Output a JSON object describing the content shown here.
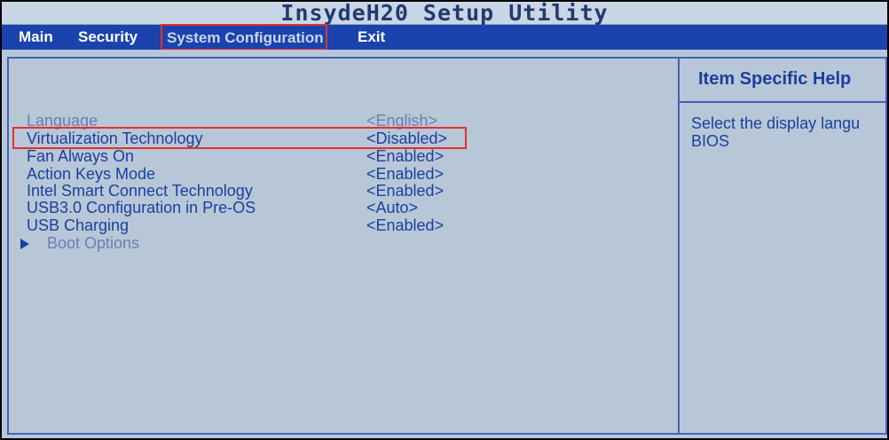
{
  "app": {
    "title": "InsydeH20 Setup Utility"
  },
  "menu": {
    "items": [
      {
        "label": "Main"
      },
      {
        "label": "Security"
      },
      {
        "label": "System Configuration"
      },
      {
        "label": "Exit"
      }
    ],
    "selected": "System Configuration"
  },
  "settings": [
    {
      "label": "Language",
      "value": "<English>"
    },
    {
      "label": "Virtualization Technology",
      "value": "<Disabled>"
    },
    {
      "label": "Fan Always On",
      "value": "<Enabled>"
    },
    {
      "label": "Action Keys Mode",
      "value": "<Enabled>"
    },
    {
      "label": "Intel Smart Connect Technology",
      "value": "<Enabled>"
    },
    {
      "label": "USB3.0 Configuration in Pre-OS",
      "value": "<Auto>"
    },
    {
      "label": "USB Charging",
      "value": "<Enabled>"
    }
  ],
  "submenu": {
    "boot_options": "Boot Options",
    "icon": "triangle-right-icon"
  },
  "help": {
    "title": "Item Specific Help",
    "line1": "Select the display langu",
    "line2": "BIOS"
  },
  "colors": {
    "menu_bar": "#1a43ae",
    "content_bg": "#b8c7d8",
    "text_blue": "#1b3f9e",
    "highlight_red": "#e0322f",
    "title_bar": "#c9d6e6"
  }
}
